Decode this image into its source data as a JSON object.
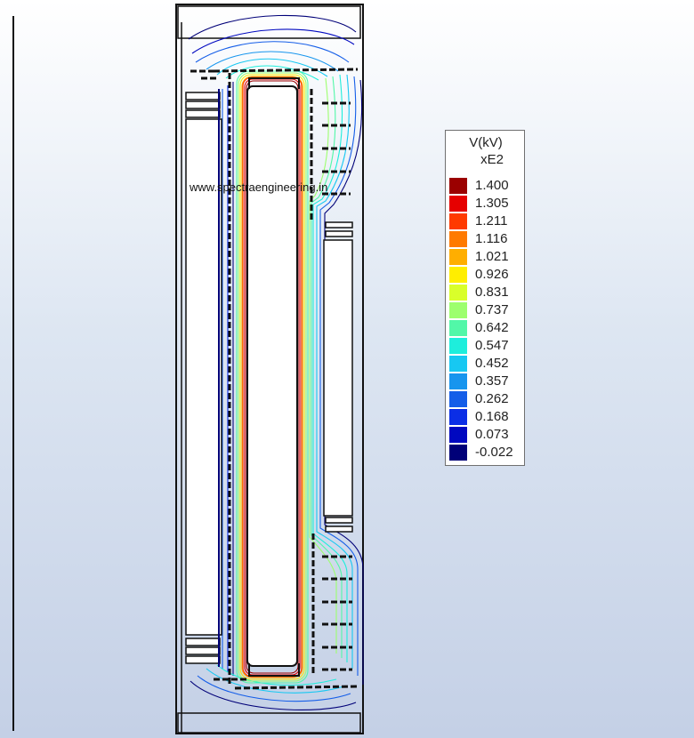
{
  "watermark": "www.spectraengineering.in",
  "legend": {
    "title_line1": "V(kV)",
    "title_line2": "xE2",
    "levels": [
      {
        "value": "1.400",
        "color": "#9b0000"
      },
      {
        "value": "1.305",
        "color": "#e60000"
      },
      {
        "value": "1.211",
        "color": "#ff3a00"
      },
      {
        "value": "1.116",
        "color": "#ff7a00"
      },
      {
        "value": "1.021",
        "color": "#ffae00"
      },
      {
        "value": "0.926",
        "color": "#ffee00"
      },
      {
        "value": "0.831",
        "color": "#d9ff2a"
      },
      {
        "value": "0.737",
        "color": "#9dff6e"
      },
      {
        "value": "0.642",
        "color": "#52f7a8"
      },
      {
        "value": "0.547",
        "color": "#1eeedc"
      },
      {
        "value": "0.452",
        "color": "#17c8f2"
      },
      {
        "value": "0.357",
        "color": "#1795ee"
      },
      {
        "value": "0.262",
        "color": "#155ee8"
      },
      {
        "value": "0.168",
        "color": "#0b2ee6"
      },
      {
        "value": "0.073",
        "color": "#0008c0"
      },
      {
        "value": "-0.022",
        "color": "#000078"
      }
    ]
  }
}
